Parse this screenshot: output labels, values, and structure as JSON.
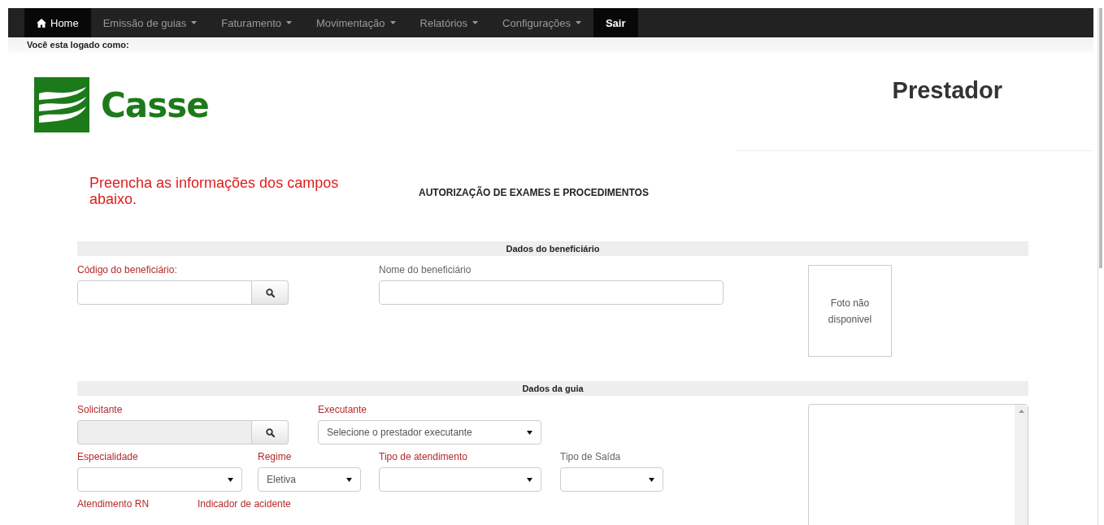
{
  "nav": {
    "items": [
      {
        "label": "Home",
        "kind": "home",
        "selected": true
      },
      {
        "label": "Emissão de guias",
        "kind": "dropdown",
        "selected": false
      },
      {
        "label": "Faturamento",
        "kind": "dropdown",
        "selected": false
      },
      {
        "label": "Movimentação",
        "kind": "dropdown",
        "selected": false
      },
      {
        "label": "Relatórios",
        "kind": "dropdown",
        "selected": false
      },
      {
        "label": "Configurações",
        "kind": "dropdown",
        "selected": false
      },
      {
        "label": "Sair",
        "kind": "logout",
        "selected": false
      }
    ]
  },
  "login_bar": {
    "text": "Você esta logado como:"
  },
  "header": {
    "logo_text": "Casse",
    "title": "Prestador"
  },
  "intro": {
    "instruction": "Preencha as informações dos campos abaixo.",
    "form_title": "AUTORIZAÇÃO DE EXAMES E PROCEDIMENTOS"
  },
  "sections": [
    {
      "title": "Dados do beneficiário",
      "rows": [
        {
          "fields": [
            {
              "kind": "search",
              "label": "Código do beneficiário:",
              "required": true
            },
            {
              "kind": "text",
              "label": "Nome do beneficiário",
              "required": false
            }
          ]
        }
      ],
      "side": {
        "kind": "photo",
        "text": "Foto não disponivel"
      }
    },
    {
      "title": "Dados da guia",
      "rows": [
        {
          "fields": [
            {
              "kind": "search",
              "label": "Solicitante",
              "required": true,
              "disabled": true
            },
            {
              "kind": "select",
              "label": "Executante",
              "required": true,
              "value": "Selecione o prestador executante"
            }
          ]
        },
        {
          "fields": [
            {
              "kind": "select",
              "label": "Especialidade",
              "required": true
            },
            {
              "kind": "select",
              "label": "Regime",
              "required": true,
              "value": "Eletiva"
            },
            {
              "kind": "select",
              "label": "Tipo de atendimento",
              "required": true
            },
            {
              "kind": "select",
              "label": "Tipo de Saída",
              "required": false
            }
          ]
        },
        {
          "fields": [
            {
              "kind": "label",
              "label": "Atendimento RN",
              "required": true
            },
            {
              "kind": "label",
              "label": "Indicador de acidente",
              "required": true
            }
          ]
        }
      ],
      "side": {
        "kind": "textarea"
      }
    }
  ]
}
